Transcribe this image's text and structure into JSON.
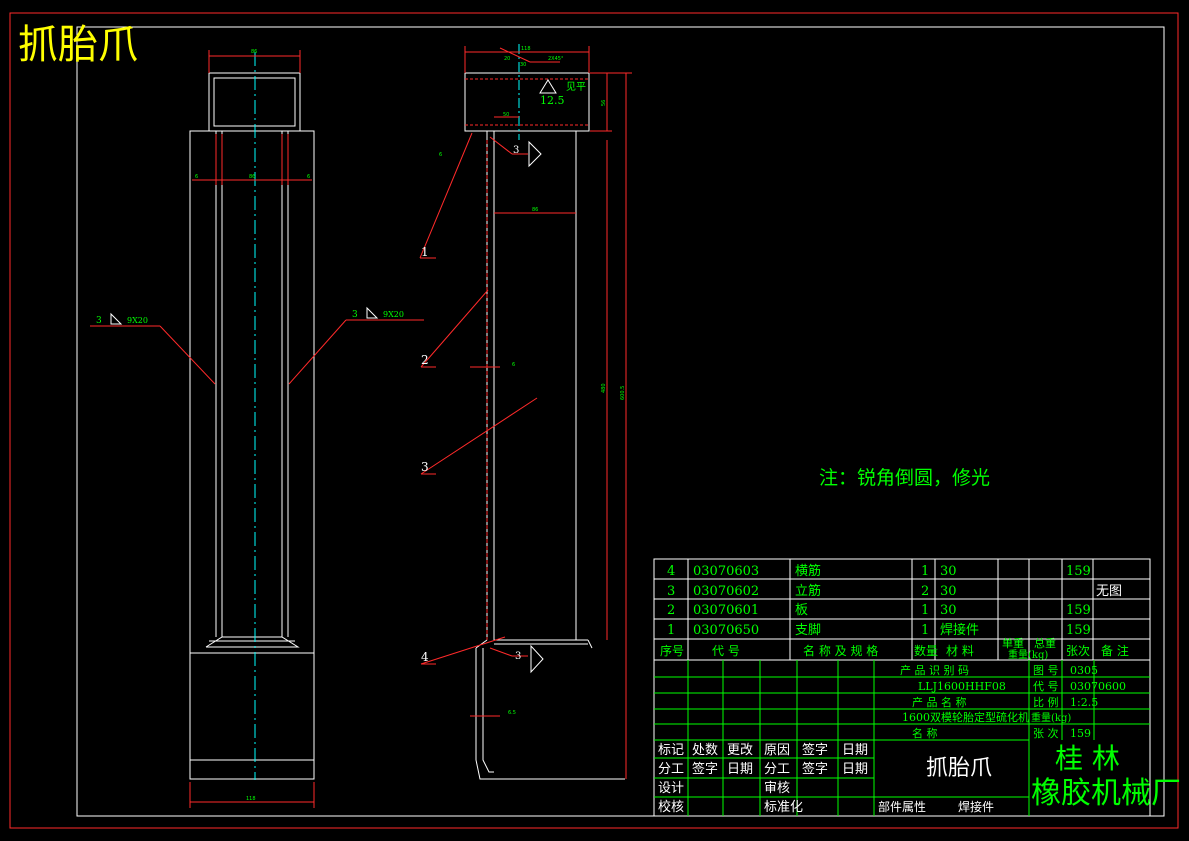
{
  "header": {
    "title": "抓胎爪"
  },
  "note": "注：锐角倒圆，修光",
  "front_view": {
    "dim_top": "86",
    "dim_inner": "86",
    "dim_left": "6",
    "dim_right": "6",
    "dim_bottom": "118",
    "weld_left": {
      "num": "3",
      "spec": "9X20"
    },
    "weld_right": {
      "num": "3",
      "spec": "9X20"
    }
  },
  "side_view": {
    "dim_top": "118",
    "dim_a": "20",
    "dim_b": "30",
    "dim_c": "2X45°",
    "dim_d": "50",
    "dim_e": "86",
    "dim_f": "6",
    "dim_g": "6",
    "dim_h": "6.5",
    "dim_height": "480",
    "dim_total": "600.5",
    "dim_right": "56",
    "weld_top": "3",
    "weld_bottom": "3",
    "surface_note": "见平",
    "roughness": "12.5",
    "balloons": [
      "1",
      "2",
      "3",
      "4"
    ]
  },
  "bom": {
    "rows": [
      {
        "seq": "4",
        "code": "03070603",
        "name": "横筋",
        "qty": "1",
        "material": "30",
        "unit_wt": "",
        "total_wt": "159",
        "remark": ""
      },
      {
        "seq": "3",
        "code": "03070602",
        "name": "立筋",
        "qty": "2",
        "material": "30",
        "unit_wt": "",
        "total_wt": "",
        "remark": "无图"
      },
      {
        "seq": "2",
        "code": "03070601",
        "name": "板",
        "qty": "1",
        "material": "30",
        "unit_wt": "",
        "total_wt": "159",
        "remark": ""
      },
      {
        "seq": "1",
        "code": "03070650",
        "name": "支脚",
        "qty": "1",
        "material": "焊接件",
        "unit_wt": "",
        "total_wt": "159",
        "remark": ""
      }
    ],
    "headers": {
      "seq": "序号",
      "code": "代  号",
      "name": "名 称 及 规 格",
      "qty": "数量",
      "material": "材  料",
      "unit_wt": "单重",
      "total_wt": "总重",
      "weight_unit": "重量(kg)",
      "sheet": "张次",
      "remark": "备  注"
    }
  },
  "title_block": {
    "product_code_label": "产  品  识  别  码",
    "product_code": "LLJ1600HHF08",
    "product_name_label": "产  品  名  称",
    "product_name": "1600双模轮胎定型硫化机",
    "name_label": "名    称",
    "drawing_no_label": "图  号",
    "drawing_no": "0305",
    "code_label": "代  号",
    "code": "03070600",
    "scale_label": "比  例",
    "scale": "1:2.5",
    "weight_label": "重量(kg)",
    "sheet_label": "张  次",
    "sheet": "159",
    "part_name": "抓胎爪",
    "company_1": "桂  林",
    "company_2": "橡胶机械厂",
    "sig_labels_row1": [
      "标记",
      "处数",
      "更改",
      "原因",
      "签字",
      "日期"
    ],
    "sig_labels_row2": [
      "分工",
      "签字",
      "日期",
      "分工",
      "签字",
      "日期"
    ],
    "sig_design": "设计",
    "sig_review": "审核",
    "sig_check": "校核",
    "sig_standard": "标准化",
    "attr_label": "部件属性",
    "attr_value": "焊接件"
  }
}
